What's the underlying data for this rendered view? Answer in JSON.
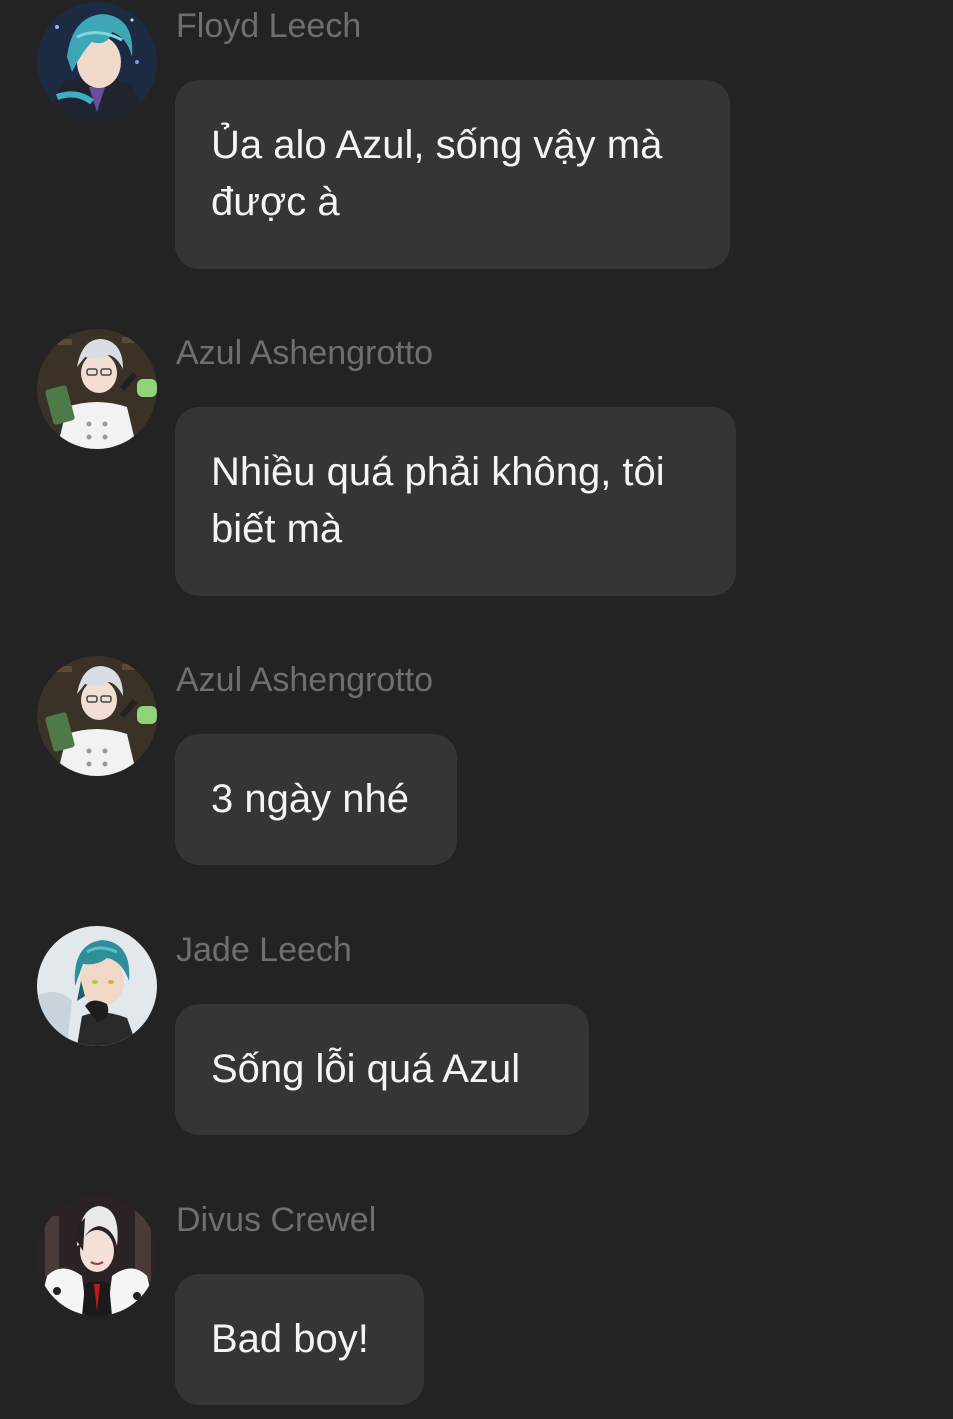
{
  "messages": [
    {
      "sender": "Floyd Leech",
      "text": "Ủa alo Azul, sống vậy mà được à",
      "avatar": "floyd-avatar"
    },
    {
      "sender": "Azul Ashengrotto",
      "text": "Nhiều quá phải không, tôi biết mà",
      "avatar": "azul-avatar"
    },
    {
      "sender": "Azul Ashengrotto",
      "text": "3 ngày nhé",
      "avatar": "azul-avatar"
    },
    {
      "sender": "Jade Leech",
      "text": "Sống lỗi quá Azul",
      "avatar": "jade-avatar"
    },
    {
      "sender": "Divus Crewel",
      "text": "Bad boy!",
      "avatar": "crewel-avatar"
    }
  ],
  "colors": {
    "background": "#232323",
    "bubble": "#353535",
    "sender_text": "#6f6f6f",
    "message_text": "#f4f4f4"
  }
}
